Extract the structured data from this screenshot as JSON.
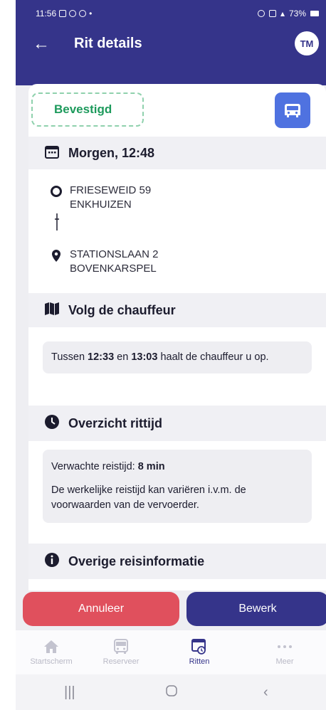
{
  "status_bar": {
    "time": "11:56",
    "battery": "73%"
  },
  "header": {
    "title": "Rit details",
    "back_icon": "arrow-left-icon",
    "avatar_initials": "TM"
  },
  "ride": {
    "status": "Bevestigd",
    "status_color": "#1d9a5c",
    "mode_icon": "car-icon",
    "datetime": "Morgen, 12:48",
    "pickup": {
      "line1": "FRIESEWEID 59",
      "line2": "ENKHUIZEN"
    },
    "dropoff": {
      "line1": "STATIONSLAAN 2",
      "line2": "BOVENKARSPEL"
    }
  },
  "follow": {
    "title": "Volg de chauffeur",
    "prefix": "Tussen ",
    "from": "12:33",
    "mid": " en ",
    "to": "13:03",
    "suffix": " haalt de chauffeur u op."
  },
  "overview": {
    "title": "Overzicht rittijd",
    "expected_label": "Verwachte reistijd: ",
    "expected_value": "8 min",
    "note": "De werkelijke reistijd kan variëren i.v.m. de voorwaarden van de vervoerder."
  },
  "other": {
    "title": "Overige reisinformatie"
  },
  "actions": {
    "cancel": "Annuleer",
    "edit": "Bewerk"
  },
  "nav": [
    {
      "label": "Startscherm",
      "icon": "home-icon"
    },
    {
      "label": "Reserveer",
      "icon": "bus-icon"
    },
    {
      "label": "Ritten",
      "icon": "calendar-clock-icon",
      "active": true
    },
    {
      "label": "Meer",
      "icon": "more-dots-icon"
    }
  ],
  "colors": {
    "brand": "#35348a",
    "cancel": "#e0505d",
    "mode_badge": "#4f72e0"
  }
}
